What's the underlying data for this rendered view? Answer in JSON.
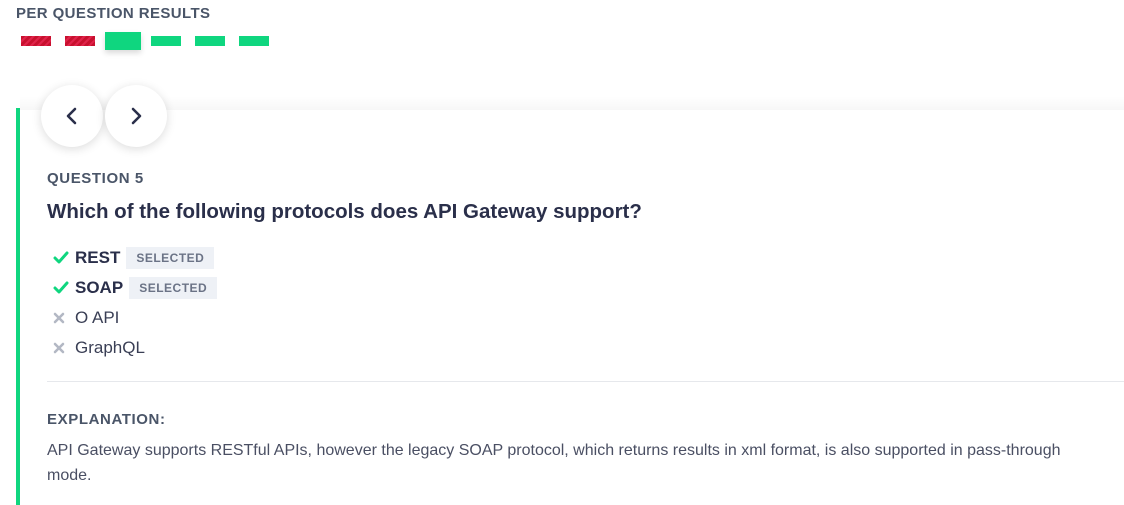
{
  "results": {
    "title": "PER QUESTION RESULTS",
    "questions": [
      {
        "status": "wrong"
      },
      {
        "status": "wrong"
      },
      {
        "status": "correct",
        "current": true
      },
      {
        "status": "correct"
      },
      {
        "status": "correct"
      },
      {
        "status": "correct"
      }
    ]
  },
  "nav": {
    "prev_icon": "chevron-left-icon",
    "next_icon": "chevron-right-icon"
  },
  "question": {
    "label": "QUESTION 5",
    "text": "Which of the following protocols does API Gateway support?",
    "answers": [
      {
        "text": "REST",
        "selected": true,
        "badge": "SELECTED",
        "icon": "check-icon"
      },
      {
        "text": "SOAP",
        "selected": true,
        "badge": "SELECTED",
        "icon": "check-icon"
      },
      {
        "text": "O API",
        "selected": false,
        "icon": "cross-icon"
      },
      {
        "text": "GraphQL",
        "selected": false,
        "icon": "cross-icon"
      }
    ]
  },
  "explanation": {
    "label": "EXPLANATION:",
    "text": "API Gateway supports RESTful APIs, however the legacy SOAP protocol, which returns results in xml format, is also supported in pass-through mode."
  },
  "colors": {
    "correct": "#0fd67f",
    "wrong": "#c8102e",
    "accent_border": "#0fd67f"
  }
}
